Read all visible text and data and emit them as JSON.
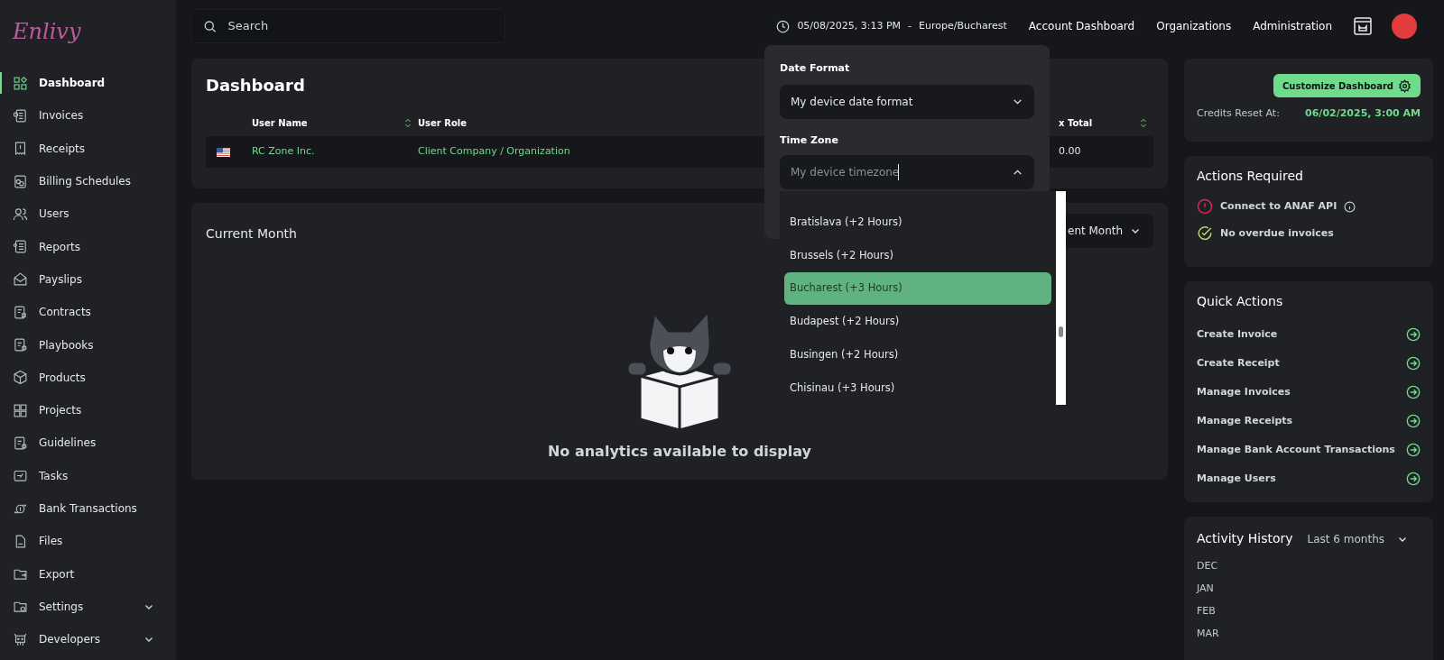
{
  "logo": {
    "text": "Enlivy"
  },
  "sidebar": {
    "items": [
      {
        "label": "Dashboard",
        "selected": true,
        "expandable": false
      },
      {
        "label": "Invoices",
        "selected": false,
        "expandable": false
      },
      {
        "label": "Receipts",
        "selected": false,
        "expandable": false
      },
      {
        "label": "Billing Schedules",
        "selected": false,
        "expandable": false
      },
      {
        "label": "Users",
        "selected": false,
        "expandable": false
      },
      {
        "label": "Reports",
        "selected": false,
        "expandable": false
      },
      {
        "label": "Payslips",
        "selected": false,
        "expandable": false
      },
      {
        "label": "Contracts",
        "selected": false,
        "expandable": false
      },
      {
        "label": "Playbooks",
        "selected": false,
        "expandable": false
      },
      {
        "label": "Products",
        "selected": false,
        "expandable": false
      },
      {
        "label": "Projects",
        "selected": false,
        "expandable": false
      },
      {
        "label": "Guidelines",
        "selected": false,
        "expandable": false
      },
      {
        "label": "Tasks",
        "selected": false,
        "expandable": false
      },
      {
        "label": "Bank Transactions",
        "selected": false,
        "expandable": false
      },
      {
        "label": "Files",
        "selected": false,
        "expandable": false
      },
      {
        "label": "Export",
        "selected": false,
        "expandable": false
      },
      {
        "label": "Settings",
        "selected": false,
        "expandable": true
      },
      {
        "label": "Developers",
        "selected": false,
        "expandable": true
      }
    ]
  },
  "topbar": {
    "search": {
      "placeholder": "Search"
    },
    "datetime": "05/08/2025, 3:13 PM",
    "separator": "-",
    "timezone": "Europe/Bucharest",
    "links": [
      "Account Dashboard",
      "Organizations",
      "Administration"
    ]
  },
  "dashboard": {
    "title": "Dashboard",
    "table": {
      "columns": [
        {
          "label": "User Name",
          "sortable": true
        },
        {
          "label": "User Role",
          "sortable": false
        },
        {
          "label": "x Total",
          "sortable": true
        }
      ],
      "rows": [
        {
          "cells": [
            "RC Zone Inc.",
            "Client Company / Organization",
            "0.00"
          ]
        }
      ]
    }
  },
  "customize_button": "Customize Dashboard",
  "credits": {
    "label": "Credits Reset At:",
    "value": "06/02/2025, 3:00 AM"
  },
  "current_month": {
    "title": "Current Month",
    "period_select": "ent Month",
    "empty_message": "No analytics available to display"
  },
  "actions_required": {
    "title": "Actions Required",
    "items": [
      {
        "text": "Connect to ANAF API",
        "kind": "error",
        "info": true
      },
      {
        "text": "No overdue invoices",
        "kind": "ok",
        "info": false
      }
    ]
  },
  "quick_actions": {
    "title": "Quick Actions",
    "items": [
      "Create Invoice",
      "Create Receipt",
      "Manage Invoices",
      "Manage Receipts",
      "Manage Bank Account Transactions",
      "Manage Users"
    ]
  },
  "activity_history": {
    "title": "Activity History",
    "range": "Last 6 months",
    "months": [
      "DEC",
      "JAN",
      "FEB",
      "MAR"
    ]
  },
  "settings_popup": {
    "date_format": {
      "label": "Date Format",
      "value": "My device date format"
    },
    "time_zone": {
      "label": "Time Zone",
      "placeholder": "My device timezone",
      "expanded": true,
      "options": [
        {
          "label": "Bratislava (+2 Hours)",
          "selected": false
        },
        {
          "label": "Brussels (+2 Hours)",
          "selected": false
        },
        {
          "label": "Bucharest (+3 Hours)",
          "selected": true
        },
        {
          "label": "Budapest (+2 Hours)",
          "selected": false
        },
        {
          "label": "Busingen (+2 Hours)",
          "selected": false
        },
        {
          "label": "Chisinau (+3 Hours)",
          "selected": false
        }
      ]
    }
  }
}
